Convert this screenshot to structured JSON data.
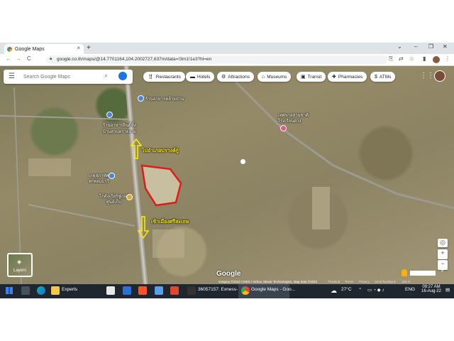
{
  "browser": {
    "tab_title": "Google Maps",
    "tab_close": "×",
    "new_tab": "+",
    "url": "google.co.th/maps/@14.7701164,104.2002727,637m/data=!3m1!1e3?hl=en",
    "back": "←",
    "forward": "→",
    "reload": "C",
    "window_controls": [
      "⌄",
      "–",
      "❐",
      "✕"
    ]
  },
  "maps": {
    "search_placeholder": "Search Google Maps",
    "chips": [
      {
        "label": "Restaurants",
        "icon": "fork-knife-icon"
      },
      {
        "label": "Hotels",
        "icon": "bed-icon"
      },
      {
        "label": "Attractions",
        "icon": "attractions-icon"
      },
      {
        "label": "Museums",
        "icon": "museum-icon"
      },
      {
        "label": "Transit",
        "icon": "transit-icon"
      },
      {
        "label": "Pharmacies",
        "icon": "pharmacy-icon"
      },
      {
        "label": "ATMs",
        "icon": "atm-icon"
      }
    ],
    "labels": {
      "poi_top": "ร้านอาหารคล้ายป่าน",
      "poi_left1": "ร้านอาหารอินดี้ทิ้ง",
      "poi_left1b": "บ้านสวนทรายงาม",
      "poi_left2": "เกตุสุภาทัศ",
      "poi_left2b": "พรพลแบรรี่",
      "poi_left3": "โกดังเกียร์ซูเปอร์",
      "poi_left3b": "ศูนย์เก็บ",
      "poi_right": "เทศบาลสามชาติ",
      "poi_right_b": "โรงเรียนดวง",
      "arrow_up_label": "ไปอำเภอปรางค์กู่",
      "arrow_down_label": "เข้าเมืองศรีสะเกษ"
    },
    "layers_label": "Layers",
    "attribution": "Imagery ©2022 CNES / Airbus, Maxar Technologies, Map data ©2022",
    "terms": [
      "Thailand",
      "Terms",
      "Privacy",
      "Send feedback",
      "100 m"
    ],
    "google_logo": "Google"
  },
  "taskbar": {
    "items": [
      "Experts",
      "36057157: Exness- Tr...",
      "Google Maps - Goo..."
    ],
    "weather": "27°C",
    "lang": "ENG",
    "time": "09:27 AM",
    "date": "16-Aug-22"
  }
}
